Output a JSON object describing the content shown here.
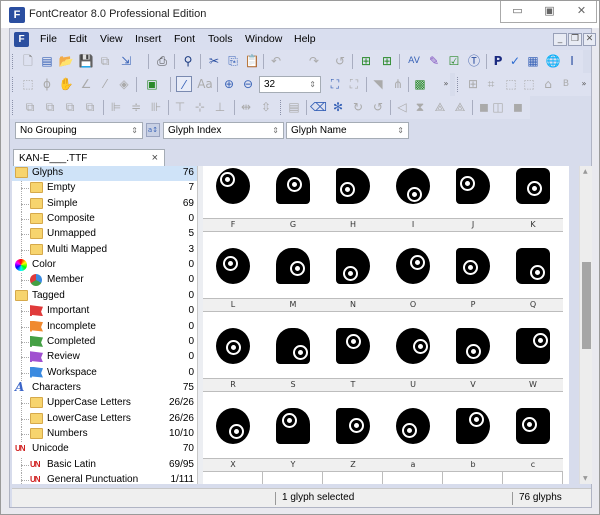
{
  "window": {
    "title": "FontCreator 8.0 Professional Edition",
    "app_icon": "fontcreator-logo-icon",
    "controls": [
      "minimize",
      "maximize",
      "close"
    ]
  },
  "menubar": {
    "items": [
      "File",
      "Edit",
      "View",
      "Insert",
      "Font",
      "Tools",
      "Window",
      "Help"
    ],
    "mdi_controls": [
      "minimize",
      "restore",
      "close"
    ]
  },
  "toolbars": {
    "row1": [
      "new-icon",
      "new-project-icon",
      "open-icon",
      "save-icon",
      "save-all-icon",
      "export-icon",
      "print-icon",
      "find-icon",
      "cut-icon",
      "copy-icon",
      "paste-icon",
      "undo-icon",
      "redo-icon",
      "refresh-icon",
      "insert-glyph-icon",
      "insert-char-icon",
      "kerning-icon",
      "test-icon",
      "validate-icon",
      "text-icon",
      "properties-icon",
      "check-icon",
      "glyph-preview-icon",
      "web-icon",
      "add-text-icon"
    ],
    "row2": [
      "rectangle-select-icon",
      "lasso-icon",
      "hand-icon",
      "measure-icon",
      "pen-icon",
      "fill-icon",
      "image-icon",
      "grid-toggle-icon",
      "metrics-icon",
      "zoom-in-icon",
      "zoom-out-icon"
    ],
    "zoom_value": "32",
    "row3": [
      "align-icon"
    ]
  },
  "filters": {
    "grouping": "No Grouping",
    "sort": "Glyph Index",
    "display": "Glyph Name"
  },
  "file_tab": {
    "name": "KAN-E___.TTF",
    "close": "×"
  },
  "tree": [
    {
      "label": "Glyphs",
      "count": "76",
      "level": 0,
      "icon": "folder-icon",
      "selected": true
    },
    {
      "label": "Empty",
      "count": "7",
      "level": 1,
      "icon": "folder-icon"
    },
    {
      "label": "Simple",
      "count": "69",
      "level": 1,
      "icon": "folder-icon"
    },
    {
      "label": "Composite",
      "count": "0",
      "level": 1,
      "icon": "folder-icon"
    },
    {
      "label": "Unmapped",
      "count": "5",
      "level": 1,
      "icon": "folder-icon"
    },
    {
      "label": "Multi Mapped",
      "count": "3",
      "level": 1,
      "icon": "folder-icon"
    },
    {
      "label": "Color",
      "count": "0",
      "level": 0,
      "icon": "color-wheel-icon"
    },
    {
      "label": "Member",
      "count": "0",
      "level": 1,
      "icon": "pie-chart-icon"
    },
    {
      "label": "Tagged",
      "count": "0",
      "level": 0,
      "icon": "tag-folder-icon"
    },
    {
      "label": "Important",
      "count": "0",
      "level": 1,
      "icon": "flag-red-icon",
      "color": "#e03a3a"
    },
    {
      "label": "Incomplete",
      "count": "0",
      "level": 1,
      "icon": "flag-orange-icon",
      "color": "#f08a30"
    },
    {
      "label": "Completed",
      "count": "0",
      "level": 1,
      "icon": "flag-green-icon",
      "color": "#44a044"
    },
    {
      "label": "Review",
      "count": "0",
      "level": 1,
      "icon": "flag-purple-icon",
      "color": "#a050d0"
    },
    {
      "label": "Workspace",
      "count": "0",
      "level": 1,
      "icon": "flag-blue-icon",
      "color": "#3a8ae0"
    },
    {
      "label": "Characters",
      "count": "75",
      "level": 0,
      "icon": "characters-icon"
    },
    {
      "label": "UpperCase Letters",
      "count": "26/26",
      "level": 1,
      "icon": "folder-icon"
    },
    {
      "label": "LowerCase Letters",
      "count": "26/26",
      "level": 1,
      "icon": "folder-icon"
    },
    {
      "label": "Numbers",
      "count": "10/10",
      "level": 1,
      "icon": "folder-icon"
    },
    {
      "label": "Unicode",
      "count": "70",
      "level": 0,
      "icon": "unicode-icon"
    },
    {
      "label": "Basic Latin",
      "count": "69/95",
      "level": 1,
      "icon": "unicode-icon"
    },
    {
      "label": "General Punctuation",
      "count": "1/111",
      "level": 1,
      "icon": "unicode-icon"
    }
  ],
  "glyph_grid": {
    "rows": [
      [
        "F",
        "G",
        "H",
        "I",
        "J",
        "K"
      ],
      [
        "L",
        "M",
        "N",
        "O",
        "P",
        "Q"
      ],
      [
        "R",
        "S",
        "T",
        "U",
        "V",
        "W"
      ],
      [
        "X",
        "Y",
        "Z",
        "a",
        "b",
        "c"
      ]
    ]
  },
  "status": {
    "selection": "1 glyph selected",
    "total": "76 glyphs"
  }
}
